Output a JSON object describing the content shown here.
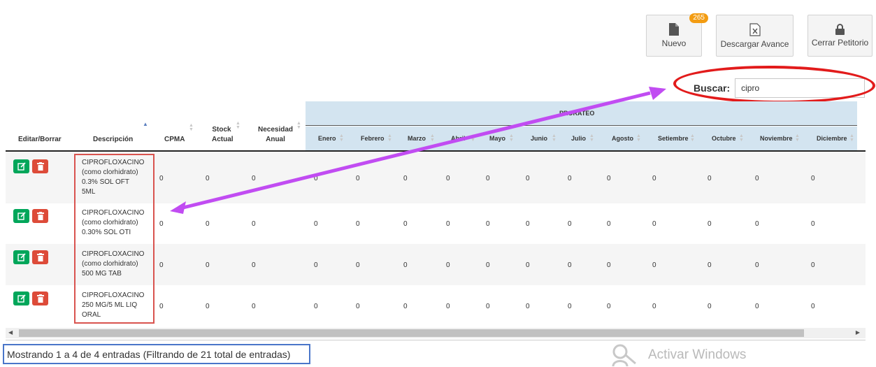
{
  "toolbar": {
    "nuevo_label": "Nuevo",
    "nuevo_badge": "265",
    "descargar_label": "Descargar Avance",
    "cerrar_label": "Cerrar Petitorio"
  },
  "search": {
    "label": "Buscar:",
    "value": "cipro"
  },
  "table": {
    "group_header": "PRORATEO",
    "headers": {
      "editar": "Editar/Borrar",
      "descripcion": "Descripción",
      "cpma": "CPMA",
      "stock_1": "Stock",
      "stock_2": "Actual",
      "necesidad_1": "Necesidad",
      "necesidad_2": "Anual"
    },
    "months": [
      "Enero",
      "Febrero",
      "Marzo",
      "Abril",
      "Mayo",
      "Junio",
      "Julio",
      "Agosto",
      "Setiembre",
      "Octubre",
      "Noviembre",
      "Diciembre"
    ],
    "rows": [
      {
        "desc": [
          "CIPROFLOXACINO",
          "(como clorhidrato)",
          "0.3% SOL OFT",
          "5ML"
        ],
        "values": [
          "0",
          "0",
          "0",
          "0",
          "0",
          "0",
          "0",
          "0",
          "0",
          "0",
          "0",
          "0",
          "0",
          "0",
          "0"
        ]
      },
      {
        "desc": [
          "CIPROFLOXACINO",
          "(como clorhidrato)",
          "0.30% SOL OTI"
        ],
        "values": [
          "0",
          "0",
          "0",
          "0",
          "0",
          "0",
          "0",
          "0",
          "0",
          "0",
          "0",
          "0",
          "0",
          "0",
          "0"
        ]
      },
      {
        "desc": [
          "CIPROFLOXACINO",
          "(como clorhidrato)",
          "500 MG TAB"
        ],
        "values": [
          "0",
          "0",
          "0",
          "0",
          "0",
          "0",
          "0",
          "0",
          "0",
          "0",
          "0",
          "0",
          "0",
          "0",
          "0"
        ]
      },
      {
        "desc": [
          "CIPROFLOXACINO",
          "250 MG/5 ML LIQ",
          "ORAL"
        ],
        "values": [
          "0",
          "0",
          "0",
          "0",
          "0",
          "0",
          "0",
          "0",
          "0",
          "0",
          "0",
          "0",
          "0",
          "0",
          "0"
        ]
      }
    ]
  },
  "footer": {
    "info": "Mostrando 1 a 4 de 4 entradas (Filtrando de 21 total de entradas)"
  },
  "watermark": {
    "text": "Activar Windows"
  },
  "colors": {
    "prorateo_band": "#d3e4f0",
    "edit_button": "#00a65a",
    "delete_button": "#dd4b39",
    "badge": "#f39c12",
    "annotation_red": "#e21b1b",
    "annotation_purple": "#c14cf2",
    "annotation_blue": "#4a76c9"
  }
}
